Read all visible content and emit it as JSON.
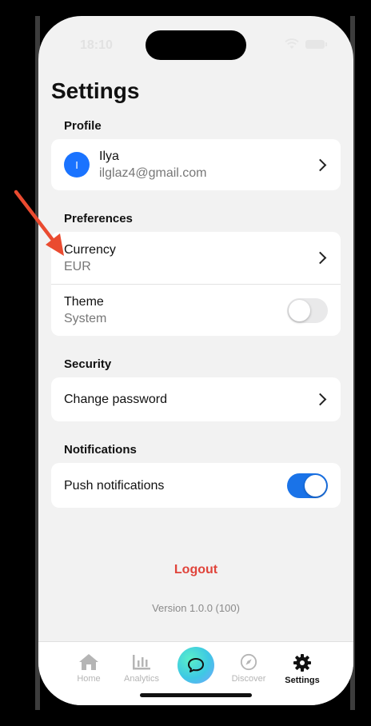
{
  "status": {
    "time": "18:10"
  },
  "page": {
    "title": "Settings"
  },
  "profile": {
    "section": "Profile",
    "avatar_initial": "I",
    "name": "Ilya",
    "email": "ilglaz4@gmail.com"
  },
  "preferences": {
    "section": "Preferences",
    "currency_label": "Currency",
    "currency_value": "EUR",
    "theme_label": "Theme",
    "theme_value": "System",
    "theme_toggle_on": false
  },
  "security": {
    "section": "Security",
    "change_password": "Change password"
  },
  "notifications": {
    "section": "Notifications",
    "push_label": "Push notifications",
    "push_toggle_on": true
  },
  "footer": {
    "logout": "Logout",
    "version": "Version 1.0.0 (100)"
  },
  "tabs": [
    {
      "label": "Home",
      "icon": "home-icon",
      "active": false
    },
    {
      "label": "Analytics",
      "icon": "analytics-icon",
      "active": false
    },
    {
      "label": "",
      "icon": "chat-icon",
      "active": false
    },
    {
      "label": "Discover",
      "icon": "compass-icon",
      "active": false
    },
    {
      "label": "Settings",
      "icon": "gear-icon",
      "active": true
    }
  ],
  "colors": {
    "accent_blue": "#1a73e8",
    "avatar_blue": "#1a73ff",
    "logout_red": "#e0443b",
    "annotation_arrow": "#ea4b30"
  }
}
